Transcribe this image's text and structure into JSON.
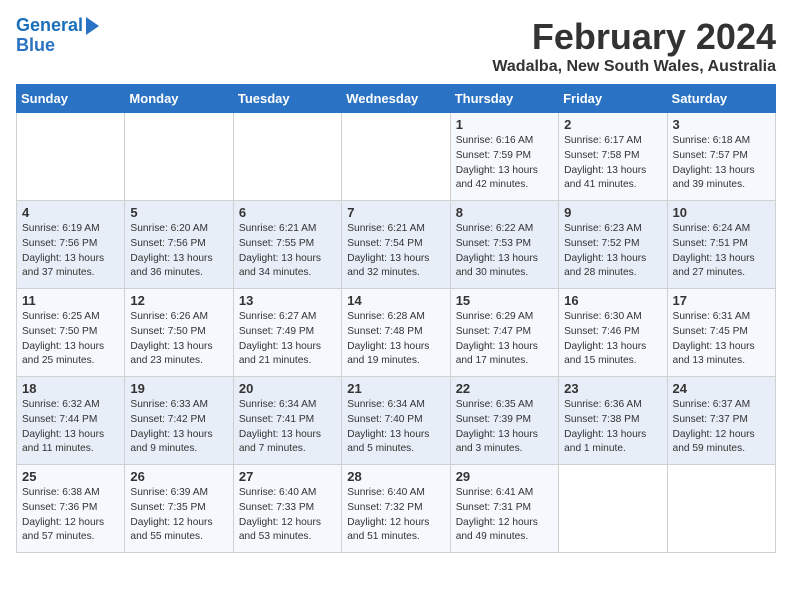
{
  "logo": {
    "line1": "General",
    "line2": "Blue"
  },
  "title": "February 2024",
  "subtitle": "Wadalba, New South Wales, Australia",
  "weekdays": [
    "Sunday",
    "Monday",
    "Tuesday",
    "Wednesday",
    "Thursday",
    "Friday",
    "Saturday"
  ],
  "weeks": [
    [
      {
        "day": "",
        "sunrise": "",
        "sunset": "",
        "daylight": ""
      },
      {
        "day": "",
        "sunrise": "",
        "sunset": "",
        "daylight": ""
      },
      {
        "day": "",
        "sunrise": "",
        "sunset": "",
        "daylight": ""
      },
      {
        "day": "",
        "sunrise": "",
        "sunset": "",
        "daylight": ""
      },
      {
        "day": "1",
        "sunrise": "Sunrise: 6:16 AM",
        "sunset": "Sunset: 7:59 PM",
        "daylight": "Daylight: 13 hours and 42 minutes."
      },
      {
        "day": "2",
        "sunrise": "Sunrise: 6:17 AM",
        "sunset": "Sunset: 7:58 PM",
        "daylight": "Daylight: 13 hours and 41 minutes."
      },
      {
        "day": "3",
        "sunrise": "Sunrise: 6:18 AM",
        "sunset": "Sunset: 7:57 PM",
        "daylight": "Daylight: 13 hours and 39 minutes."
      }
    ],
    [
      {
        "day": "4",
        "sunrise": "Sunrise: 6:19 AM",
        "sunset": "Sunset: 7:56 PM",
        "daylight": "Daylight: 13 hours and 37 minutes."
      },
      {
        "day": "5",
        "sunrise": "Sunrise: 6:20 AM",
        "sunset": "Sunset: 7:56 PM",
        "daylight": "Daylight: 13 hours and 36 minutes."
      },
      {
        "day": "6",
        "sunrise": "Sunrise: 6:21 AM",
        "sunset": "Sunset: 7:55 PM",
        "daylight": "Daylight: 13 hours and 34 minutes."
      },
      {
        "day": "7",
        "sunrise": "Sunrise: 6:21 AM",
        "sunset": "Sunset: 7:54 PM",
        "daylight": "Daylight: 13 hours and 32 minutes."
      },
      {
        "day": "8",
        "sunrise": "Sunrise: 6:22 AM",
        "sunset": "Sunset: 7:53 PM",
        "daylight": "Daylight: 13 hours and 30 minutes."
      },
      {
        "day": "9",
        "sunrise": "Sunrise: 6:23 AM",
        "sunset": "Sunset: 7:52 PM",
        "daylight": "Daylight: 13 hours and 28 minutes."
      },
      {
        "day": "10",
        "sunrise": "Sunrise: 6:24 AM",
        "sunset": "Sunset: 7:51 PM",
        "daylight": "Daylight: 13 hours and 27 minutes."
      }
    ],
    [
      {
        "day": "11",
        "sunrise": "Sunrise: 6:25 AM",
        "sunset": "Sunset: 7:50 PM",
        "daylight": "Daylight: 13 hours and 25 minutes."
      },
      {
        "day": "12",
        "sunrise": "Sunrise: 6:26 AM",
        "sunset": "Sunset: 7:50 PM",
        "daylight": "Daylight: 13 hours and 23 minutes."
      },
      {
        "day": "13",
        "sunrise": "Sunrise: 6:27 AM",
        "sunset": "Sunset: 7:49 PM",
        "daylight": "Daylight: 13 hours and 21 minutes."
      },
      {
        "day": "14",
        "sunrise": "Sunrise: 6:28 AM",
        "sunset": "Sunset: 7:48 PM",
        "daylight": "Daylight: 13 hours and 19 minutes."
      },
      {
        "day": "15",
        "sunrise": "Sunrise: 6:29 AM",
        "sunset": "Sunset: 7:47 PM",
        "daylight": "Daylight: 13 hours and 17 minutes."
      },
      {
        "day": "16",
        "sunrise": "Sunrise: 6:30 AM",
        "sunset": "Sunset: 7:46 PM",
        "daylight": "Daylight: 13 hours and 15 minutes."
      },
      {
        "day": "17",
        "sunrise": "Sunrise: 6:31 AM",
        "sunset": "Sunset: 7:45 PM",
        "daylight": "Daylight: 13 hours and 13 minutes."
      }
    ],
    [
      {
        "day": "18",
        "sunrise": "Sunrise: 6:32 AM",
        "sunset": "Sunset: 7:44 PM",
        "daylight": "Daylight: 13 hours and 11 minutes."
      },
      {
        "day": "19",
        "sunrise": "Sunrise: 6:33 AM",
        "sunset": "Sunset: 7:42 PM",
        "daylight": "Daylight: 13 hours and 9 minutes."
      },
      {
        "day": "20",
        "sunrise": "Sunrise: 6:34 AM",
        "sunset": "Sunset: 7:41 PM",
        "daylight": "Daylight: 13 hours and 7 minutes."
      },
      {
        "day": "21",
        "sunrise": "Sunrise: 6:34 AM",
        "sunset": "Sunset: 7:40 PM",
        "daylight": "Daylight: 13 hours and 5 minutes."
      },
      {
        "day": "22",
        "sunrise": "Sunrise: 6:35 AM",
        "sunset": "Sunset: 7:39 PM",
        "daylight": "Daylight: 13 hours and 3 minutes."
      },
      {
        "day": "23",
        "sunrise": "Sunrise: 6:36 AM",
        "sunset": "Sunset: 7:38 PM",
        "daylight": "Daylight: 13 hours and 1 minute."
      },
      {
        "day": "24",
        "sunrise": "Sunrise: 6:37 AM",
        "sunset": "Sunset: 7:37 PM",
        "daylight": "Daylight: 12 hours and 59 minutes."
      }
    ],
    [
      {
        "day": "25",
        "sunrise": "Sunrise: 6:38 AM",
        "sunset": "Sunset: 7:36 PM",
        "daylight": "Daylight: 12 hours and 57 minutes."
      },
      {
        "day": "26",
        "sunrise": "Sunrise: 6:39 AM",
        "sunset": "Sunset: 7:35 PM",
        "daylight": "Daylight: 12 hours and 55 minutes."
      },
      {
        "day": "27",
        "sunrise": "Sunrise: 6:40 AM",
        "sunset": "Sunset: 7:33 PM",
        "daylight": "Daylight: 12 hours and 53 minutes."
      },
      {
        "day": "28",
        "sunrise": "Sunrise: 6:40 AM",
        "sunset": "Sunset: 7:32 PM",
        "daylight": "Daylight: 12 hours and 51 minutes."
      },
      {
        "day": "29",
        "sunrise": "Sunrise: 6:41 AM",
        "sunset": "Sunset: 7:31 PM",
        "daylight": "Daylight: 12 hours and 49 minutes."
      },
      {
        "day": "",
        "sunrise": "",
        "sunset": "",
        "daylight": ""
      },
      {
        "day": "",
        "sunrise": "",
        "sunset": "",
        "daylight": ""
      }
    ]
  ]
}
